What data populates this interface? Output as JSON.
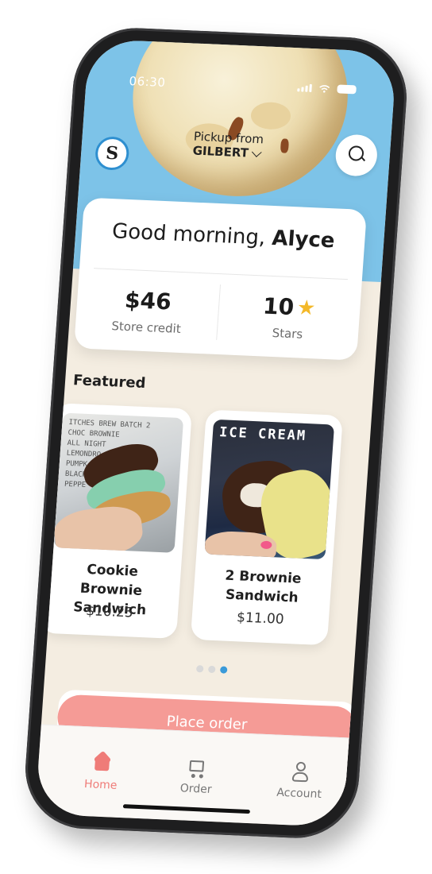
{
  "status_bar": {
    "time": "06:30"
  },
  "header": {
    "logo_icon": "brand-logo",
    "logo_mark": "S",
    "pickup_label": "Pickup from",
    "pickup_store": "GILBERT",
    "search_icon": "search-icon"
  },
  "greeting": {
    "prefix": "Good morning,",
    "name": "Alyce"
  },
  "stats": [
    {
      "value": "$46",
      "label": "Store credit"
    },
    {
      "value": "10",
      "label": "Stars",
      "icon": "star-icon"
    }
  ],
  "featured": {
    "title": "Featured",
    "products": [
      {
        "name": "Cookie Brownie Sandwich",
        "price": "$10.25",
        "image_text": "ITCHES BREW BATCH 2\nCHOC BROWNIE\nALL NIGHT\nLEMONDRO\nPUMPK\nBLACKB\nPEPPE"
      },
      {
        "name": "2 Brownie Sandwich",
        "price": "$11.00",
        "image_text": "ICE CREAM"
      }
    ],
    "carousel": {
      "count": 3,
      "active_index": 2
    }
  },
  "order": {
    "button_label": "Place order"
  },
  "tabbar": [
    {
      "label": "Home",
      "icon": "home-icon",
      "active": true
    },
    {
      "label": "Order",
      "icon": "cart-icon",
      "active": false
    },
    {
      "label": "Account",
      "icon": "account-icon",
      "active": false
    }
  ],
  "colors": {
    "sky": "#7dc3e8",
    "cream_bg": "#f4ede1",
    "accent_pink": "#f59b96",
    "active_tab": "#ef7c78",
    "star": "#f3b829",
    "dot_active": "#3a9ad9"
  }
}
